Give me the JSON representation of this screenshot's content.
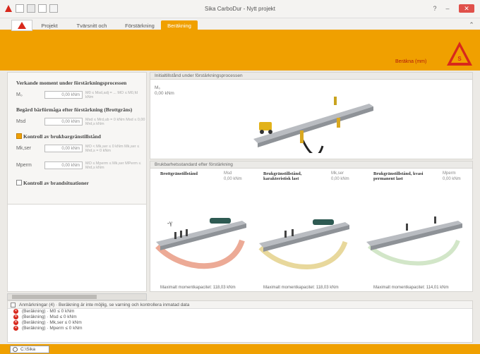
{
  "window": {
    "title": "Sika CarboDur - Nytt projekt"
  },
  "tabs": [
    "Projekt",
    "Tvärsnitt och belastning",
    "Förstärkning",
    "Beräkning"
  ],
  "ribbon": {
    "link_label": "Beräkna (mm)"
  },
  "left_panel": {
    "section1_title": "Verkande moment under förstärkningsprocessen",
    "section1_field_label": "M₀",
    "section1_value": "0,00 kNm",
    "section1_note": "M0 ≤ Msd,adj = ... MO ≤ M0,fd kNm",
    "section2_title": "Begärd bärförmåga efter förstärkning (Brottgräns)",
    "section2_field_label": "Msd",
    "section2_value": "0,00 kNm",
    "section2_note": "Msd ≤ Mrd,ub = 0 kNm Msd ≤ 0,00 Mrd,s kNm",
    "check1_label": "Kontroll av brukbargränstillstånd",
    "field3_label": "Mk,ser",
    "field3_value": "0,00 kNm",
    "field3_note": "MO < Mk,ser ≤ 0 kNm Mk,ser ≤ Mrd,s = 0 kNm",
    "field4_label": "Mperm",
    "field4_value": "0,00 kNm",
    "field4_note": "MO ≤ Mperm ≤ Mk,ser MPerm ≤ Mrd,s kNm",
    "check2_label": "Kontroll av brandsituationer"
  },
  "panel_top": {
    "title": "Initialtillstånd under förstärkningsprocessen",
    "m_label": "M₀",
    "m_value": "0,00 kNm"
  },
  "panel_bottom": {
    "title": "Brukbarhetsstandard efter förstärkning",
    "cards": [
      {
        "title": "Brottgränstillstånd",
        "label": "Msd",
        "value": "0,00 kNm",
        "moment": "Maximalt momentkapacitet: 118,03 kNm"
      },
      {
        "title": "Brukgränstillstånd, karakteristisk last",
        "label": "Mk,ser",
        "value": "0,00 kNm",
        "moment": "Maximalt momentkapacitet: 118,03 kNm"
      },
      {
        "title": "Brukgränstillstånd, kvasi permanent last",
        "label": "Mperm",
        "value": "0,00 kNm",
        "moment": "Maximalt momentkapacitet: 114,01 kNm"
      }
    ]
  },
  "notices": {
    "header": "Anmärkningar (4) · Beräkning är inte möjlig, se varning och kontrollera inmatad data",
    "items": [
      "(Beräkning) · M0 ≤ 0 kNm",
      "(Beräkning) · Msd ≤ 0 kNm",
      "(Beräkning) · Mk,ser ≤ 0 kNm",
      "(Beräkning) · Mperm ≤ 0 kNm"
    ]
  },
  "status": {
    "button_label": "C:\\Sika"
  },
  "colors": {
    "accent": "#f0a000",
    "danger": "#d8281c",
    "brand": "#b2180d"
  }
}
